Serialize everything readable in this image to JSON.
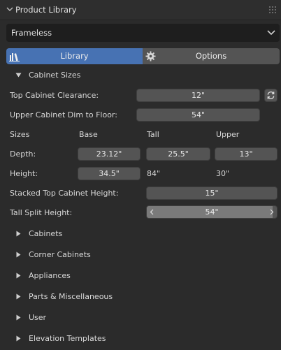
{
  "panel": {
    "title": "Product Library"
  },
  "library_dropdown": {
    "value": "Frameless"
  },
  "tabs": {
    "library": "Library",
    "options": "Options"
  },
  "cabinet_sizes": {
    "header": "Cabinet Sizes",
    "top_clearance": {
      "label": "Top Cabinet Clearance:",
      "value": "12\""
    },
    "upper_dim_floor": {
      "label": "Upper Cabinet Dim to Floor:",
      "value": "54\""
    },
    "columns": {
      "sizes": "Sizes",
      "base": "Base",
      "tall": "Tall",
      "upper": "Upper"
    },
    "depth": {
      "label": "Depth:",
      "base": "23.12\"",
      "tall": "25.5\"",
      "upper": "13\""
    },
    "height": {
      "label": "Height:",
      "base": "34.5\"",
      "tall": "84\"",
      "upper": "30\""
    },
    "stacked_top": {
      "label": "Stacked Top Cabinet Height:",
      "value": "15\""
    },
    "tall_split": {
      "label": "Tall Split Height:",
      "value": "54\"",
      "fill_fraction": 0.97
    }
  },
  "sections": [
    "Cabinets",
    "Corner Cabinets",
    "Appliances",
    "Parts & Miscellaneous",
    "User",
    "Elevation Templates"
  ]
}
